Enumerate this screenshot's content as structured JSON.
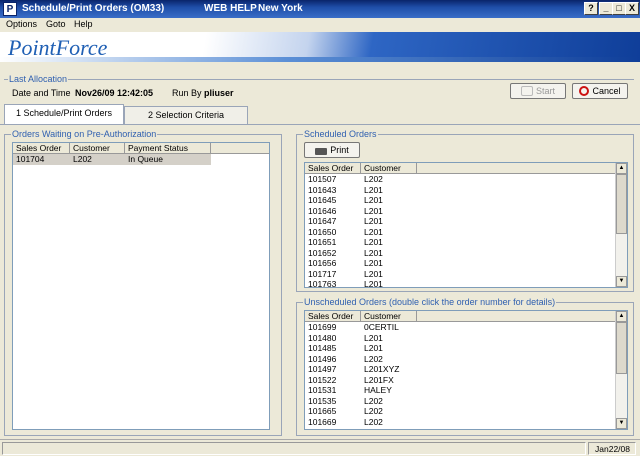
{
  "window": {
    "title": "Schedule/Print Orders (OM33)",
    "help": "WEB HELP",
    "region": "New York",
    "controls": [
      "?",
      "_",
      "□",
      "X"
    ]
  },
  "menu": [
    "Options",
    "Goto",
    "Help"
  ],
  "banner": {
    "logo": "PointForce"
  },
  "last_allocation": {
    "legend": "Last Allocation",
    "date_label": "Date and Time",
    "date_value": "Nov26/09  12:42:05",
    "runby_label": "Run By",
    "runby_value": "pliuser",
    "start_label": "Start",
    "cancel_label": "Cancel"
  },
  "tabs": [
    "1 Schedule/Print Orders",
    "2 Selection Criteria"
  ],
  "waiting": {
    "legend": "Orders Waiting on Pre-Authorization",
    "columns": [
      "Sales Order",
      "Customer",
      "Payment Status"
    ],
    "rows": [
      [
        "101704",
        "L202",
        "In Queue"
      ]
    ]
  },
  "scheduled": {
    "legend": "Scheduled Orders",
    "print_label": "Print",
    "columns": [
      "Sales Order",
      "Customer"
    ],
    "rows": [
      [
        "101507",
        "L202"
      ],
      [
        "101643",
        "L201"
      ],
      [
        "101645",
        "L201"
      ],
      [
        "101646",
        "L201"
      ],
      [
        "101647",
        "L201"
      ],
      [
        "101650",
        "L201"
      ],
      [
        "101651",
        "L201"
      ],
      [
        "101652",
        "L201"
      ],
      [
        "101656",
        "L201"
      ],
      [
        "101717",
        "L201"
      ],
      [
        "101763",
        "L201"
      ]
    ]
  },
  "unscheduled": {
    "legend": "Unscheduled Orders (double click the order number for details)",
    "columns": [
      "Sales Order",
      "Customer"
    ],
    "rows": [
      [
        "101699",
        "0CERTIL"
      ],
      [
        "101480",
        "L201"
      ],
      [
        "101485",
        "L201"
      ],
      [
        "101496",
        "L202"
      ],
      [
        "101497",
        "L201XYZ"
      ],
      [
        "101522",
        "L201FX"
      ],
      [
        "101531",
        "HALEY"
      ],
      [
        "101535",
        "L202"
      ],
      [
        "101665",
        "L202"
      ],
      [
        "101669",
        "L202"
      ]
    ]
  },
  "status": {
    "date": "Jan22/08"
  },
  "colors": {
    "title_bar": "#0a246a",
    "accent_text": "#3060b0",
    "face": "#ece9d8"
  }
}
